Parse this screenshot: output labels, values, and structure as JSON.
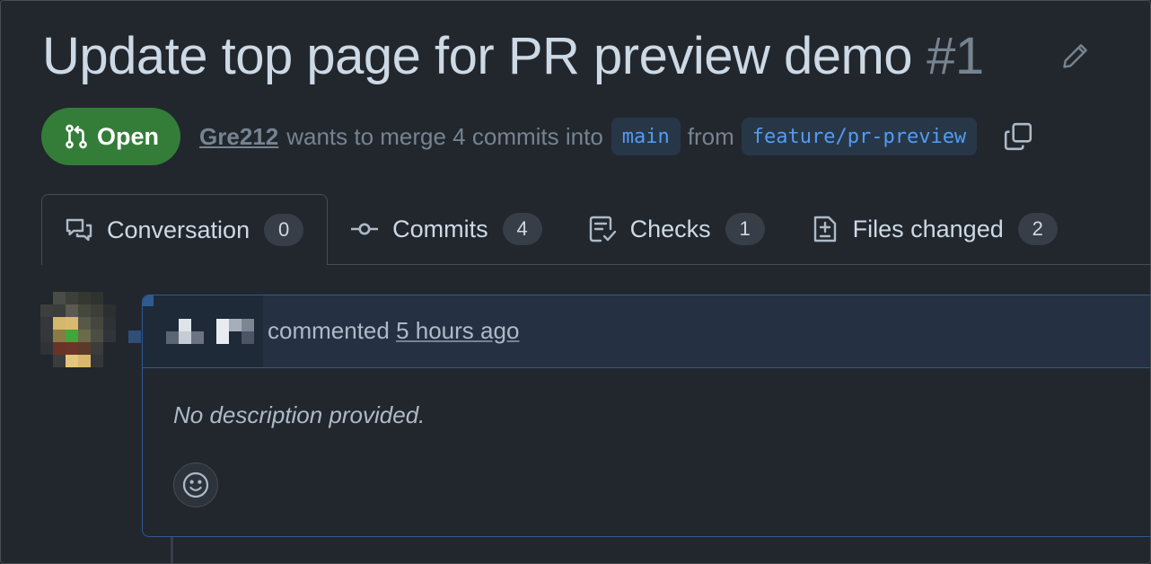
{
  "pull_request": {
    "title": "Update top page for PR preview demo",
    "number": "#1",
    "state": "Open",
    "author": "Gre212",
    "merge_text": "wants to merge 4 commits into",
    "base_branch": "main",
    "from_text": "from",
    "head_branch": "feature/pr-preview"
  },
  "tabs": [
    {
      "label": "Conversation",
      "count": "0",
      "icon": "comment-discussion-icon"
    },
    {
      "label": "Commits",
      "count": "4",
      "icon": "git-commit-icon"
    },
    {
      "label": "Checks",
      "count": "1",
      "icon": "checklist-icon"
    },
    {
      "label": "Files changed",
      "count": "2",
      "icon": "file-diff-icon"
    }
  ],
  "comment": {
    "action": "commented",
    "timestamp": "5 hours ago",
    "body": "No description provided."
  },
  "colors": {
    "background": "#22272e",
    "open_green": "#347d39",
    "link_blue": "#539bf5",
    "highlight_border": "#2f5a8f"
  },
  "icons": {
    "edit": "pencil-icon",
    "copy": "copy-icon",
    "state": "git-pull-request-icon",
    "reaction": "smiley-icon"
  }
}
